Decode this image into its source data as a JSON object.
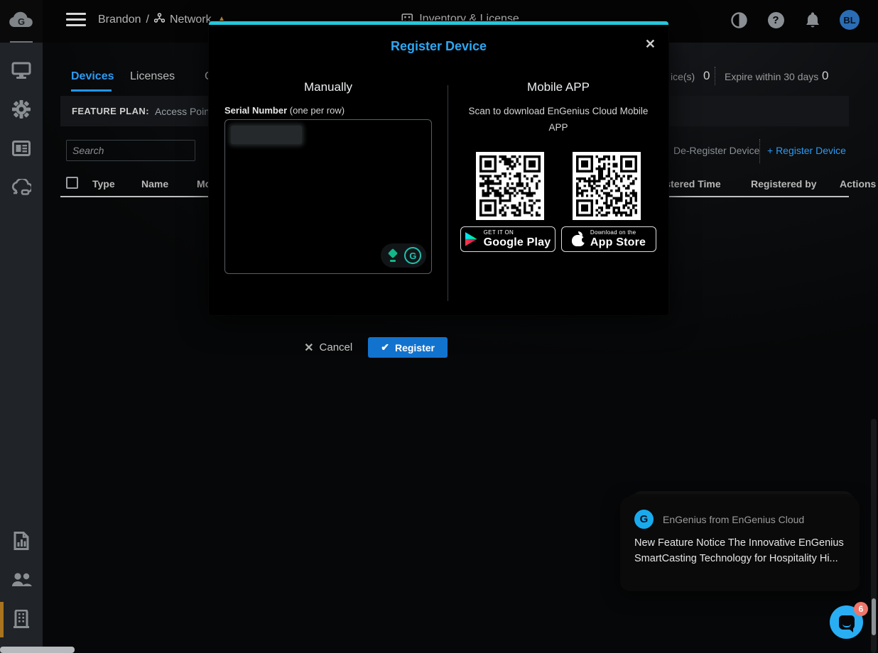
{
  "colors": {
    "accent_blue": "#2196f3",
    "modal_title_blue": "#2da7f2",
    "modal_top_border_cyan": "#26c6da",
    "register_button_blue": "#1273cf",
    "warning_amber": "#cf9b3d",
    "chat_blue": "#29aef3",
    "chat_badge_red": "#ee756a",
    "toast_logo_blue": "#19aaee",
    "sidebar_bg": "#202327",
    "avatar_blue": "#2a6db5"
  },
  "header": {
    "breadcrumb": {
      "account": "Brandon",
      "separator": "/",
      "network": "Network"
    },
    "title": "Inventory & License",
    "avatar_initials": "BL"
  },
  "tabs": [
    {
      "label": "Devices",
      "active": true
    },
    {
      "label": "Licenses",
      "active": false
    },
    {
      "label": "C",
      "active": false
    }
  ],
  "stats": [
    {
      "label": "ice(s)",
      "value": "0"
    },
    {
      "label": "Expire within 30 days",
      "value": "0"
    }
  ],
  "feature_plan": {
    "label": "FEATURE PLAN:",
    "value": "Access Point"
  },
  "toolbar": {
    "search_placeholder": "Search",
    "deregister_label": "De-Register Device",
    "register_label": "+ Register Device"
  },
  "table": {
    "headers": [
      "Type",
      "Name",
      "Model",
      "Registered Time",
      "Registered by",
      "Actions"
    ]
  },
  "modal": {
    "title": "Register Device",
    "close_glyph": "✕",
    "manual": {
      "heading": "Manually",
      "serial_label_bold": "Serial Number",
      "serial_label_note": " (one per row)",
      "cancel_glyph": "✕",
      "cancel_label": "Cancel",
      "register_glyph": "✔",
      "register_label": "Register",
      "grammarly_g": "G"
    },
    "mobile": {
      "heading": "Mobile APP",
      "scan_text": "Scan to download EnGenius Cloud Mobile APP",
      "google_badge": {
        "small": "GET IT ON",
        "big": "Google Play"
      },
      "apple_badge": {
        "small": "Download on the",
        "big": "App Store"
      }
    }
  },
  "toast": {
    "app_name": "EnGenius from EnGenius Cloud",
    "logo_letter": "G",
    "body": "New Feature Notice The Innovative EnGenius SmartCasting Technology for Hospitality Hi..."
  },
  "chat": {
    "badge_count": "6"
  },
  "logo_letter": "G"
}
